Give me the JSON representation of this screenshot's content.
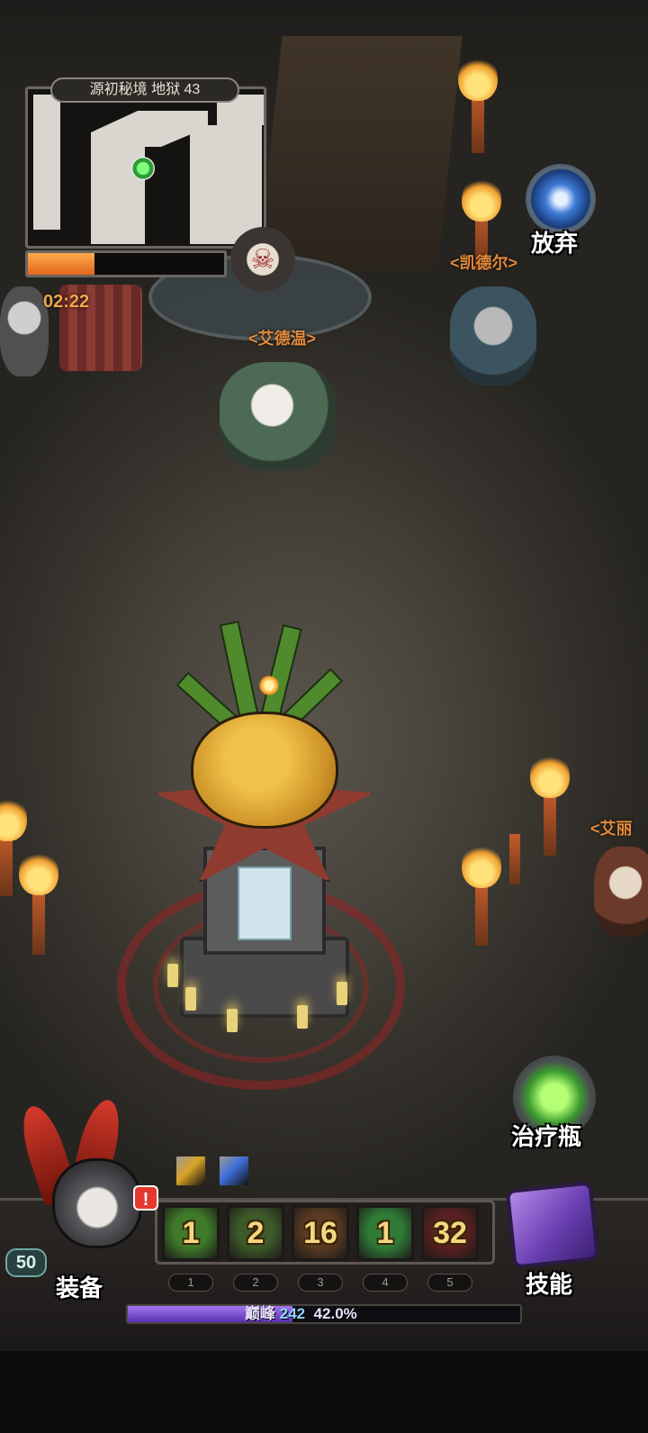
{
  "minimap": {
    "title": "源初秘境 地狱 43",
    "timer": "02:22",
    "progress_fraction": 0.34
  },
  "npcs": [
    {
      "id": "aidewen",
      "label": "<艾德温>"
    },
    {
      "id": "kaideer",
      "label": "<凯德尔>"
    },
    {
      "id": "aili_partial",
      "label": "<艾丽"
    }
  ],
  "buttons": {
    "abandon": "放弃",
    "potion": "治疗瓶",
    "skills": "技能",
    "equipment": "装备"
  },
  "hero": {
    "level": "50",
    "alert": "!"
  },
  "skill_slots": [
    {
      "count": "1",
      "key": "1",
      "color": "#3f7a2a"
    },
    {
      "count": "2",
      "key": "2",
      "color": "#3d5a2a"
    },
    {
      "count": "16",
      "key": "3",
      "color": "#5a3a22"
    },
    {
      "count": "1",
      "key": "4",
      "color": "#2f7a36"
    },
    {
      "count": "32",
      "key": "5",
      "color": "#5a2020"
    }
  ],
  "buffs": [
    {
      "icon": "gold-buff-icon",
      "color": "#d9a326"
    },
    {
      "icon": "lightning-buff-icon",
      "color": "#3e6fd8"
    }
  ],
  "xp": {
    "label": "巅峰",
    "level": "242",
    "percent_text": "42.0%",
    "fraction": 0.42
  },
  "colors": {
    "accent_orange": "#e38a3c",
    "xp_purple": "#7a4fd0"
  }
}
